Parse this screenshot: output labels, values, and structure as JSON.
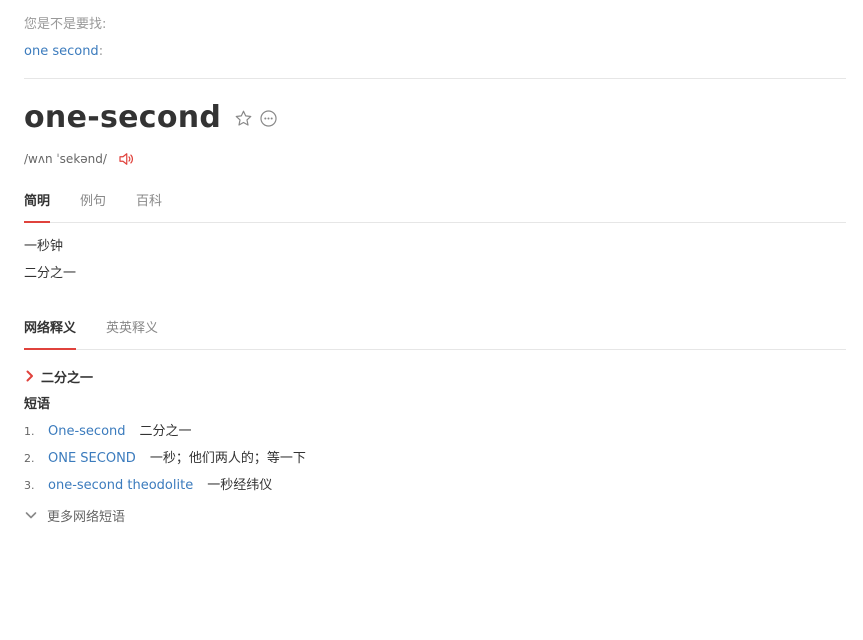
{
  "suggest": {
    "title": "您是不是要找:",
    "link": "one second",
    "colon": ":"
  },
  "entry": {
    "headword": "one-second",
    "phonetic": "/wʌn ˈsekənd/"
  },
  "tabs_basic": [
    {
      "label": "简明",
      "active": true
    },
    {
      "label": "例句",
      "active": false
    },
    {
      "label": "百科",
      "active": false
    }
  ],
  "basic_meanings": [
    "一秒钟",
    "二分之一"
  ],
  "tabs_web": [
    {
      "label": "网络释义",
      "active": true
    },
    {
      "label": "英英释义",
      "active": false
    }
  ],
  "web": {
    "definition": "二分之一",
    "phrases_title": "短语",
    "phrases": [
      {
        "num": "1.",
        "phrase": "One-second",
        "translation": "二分之一"
      },
      {
        "num": "2.",
        "phrase": "ONE SECOND",
        "translation": "一秒；他们两人的；等一下"
      },
      {
        "num": "3.",
        "phrase": "one-second theodolite",
        "translation": "一秒经纬仪"
      }
    ],
    "more_label": "更多网络短语"
  },
  "colors": {
    "accent": "#e0423c",
    "link": "#3b7bbd",
    "text": "#333333",
    "muted": "#999999"
  },
  "icons": {
    "favorite": "star-outline-icon",
    "more": "more-options-icon",
    "pronounce": "speaker-icon",
    "definition_marker": "chevron-right-icon",
    "expand": "chevron-down-icon"
  }
}
